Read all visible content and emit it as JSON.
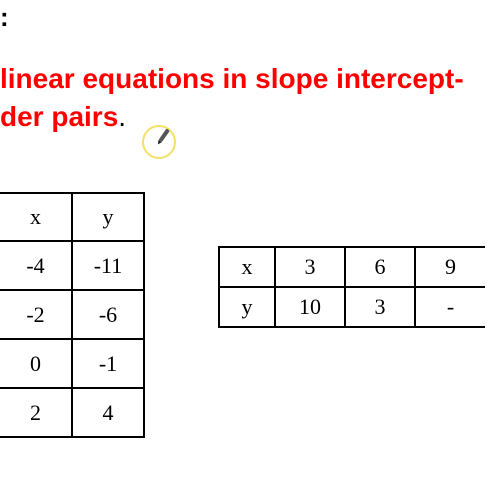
{
  "heading_colon": ":",
  "instruction": {
    "line1": " linear equations in slope intercept-",
    "line2": "der pairs",
    "period": "."
  },
  "table1": {
    "headers": {
      "x": "x",
      "y": "y"
    },
    "rows": [
      {
        "x": "-4",
        "y": "-11"
      },
      {
        "x": "-2",
        "y": "-6"
      },
      {
        "x": "0",
        "y": "-1"
      },
      {
        "x": "2",
        "y": "4"
      }
    ]
  },
  "table2": {
    "headers": {
      "x": "x",
      "y": "y"
    },
    "cols": [
      {
        "x": "3",
        "y": "10"
      },
      {
        "x": "6",
        "y": "3"
      },
      {
        "x": "9",
        "y": "-"
      }
    ]
  },
  "chart_data": [
    {
      "type": "table",
      "orientation": "vertical",
      "columns": [
        "x",
        "y"
      ],
      "rows": [
        [
          -4,
          -11
        ],
        [
          -2,
          -6
        ],
        [
          0,
          -1
        ],
        [
          2,
          4
        ]
      ]
    },
    {
      "type": "table",
      "orientation": "horizontal",
      "columns": [
        "x",
        "y"
      ],
      "rows": [
        [
          3,
          10
        ],
        [
          6,
          3
        ],
        [
          9,
          null
        ]
      ],
      "note": "rightmost column partially cut off"
    }
  ]
}
